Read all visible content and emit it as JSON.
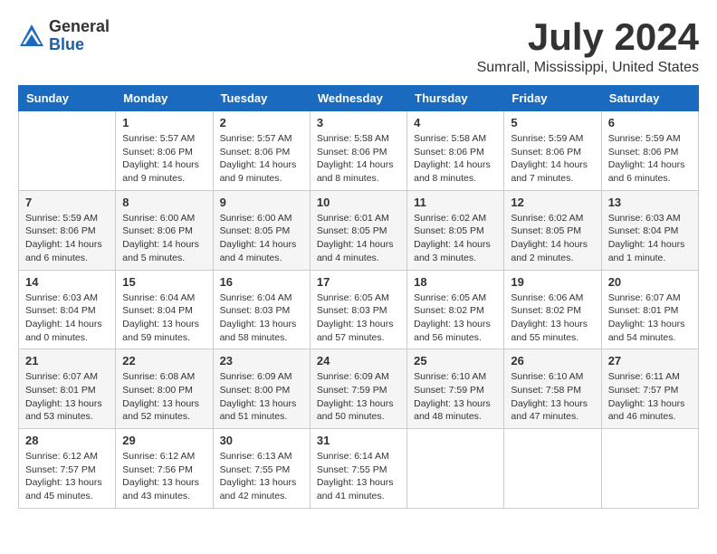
{
  "logo": {
    "general": "General",
    "blue": "Blue"
  },
  "title": {
    "month": "July 2024",
    "location": "Sumrall, Mississippi, United States"
  },
  "calendar": {
    "headers": [
      "Sunday",
      "Monday",
      "Tuesday",
      "Wednesday",
      "Thursday",
      "Friday",
      "Saturday"
    ],
    "weeks": [
      [
        {
          "day": "",
          "info": ""
        },
        {
          "day": "1",
          "info": "Sunrise: 5:57 AM\nSunset: 8:06 PM\nDaylight: 14 hours\nand 9 minutes."
        },
        {
          "day": "2",
          "info": "Sunrise: 5:57 AM\nSunset: 8:06 PM\nDaylight: 14 hours\nand 9 minutes."
        },
        {
          "day": "3",
          "info": "Sunrise: 5:58 AM\nSunset: 8:06 PM\nDaylight: 14 hours\nand 8 minutes."
        },
        {
          "day": "4",
          "info": "Sunrise: 5:58 AM\nSunset: 8:06 PM\nDaylight: 14 hours\nand 8 minutes."
        },
        {
          "day": "5",
          "info": "Sunrise: 5:59 AM\nSunset: 8:06 PM\nDaylight: 14 hours\nand 7 minutes."
        },
        {
          "day": "6",
          "info": "Sunrise: 5:59 AM\nSunset: 8:06 PM\nDaylight: 14 hours\nand 6 minutes."
        }
      ],
      [
        {
          "day": "7",
          "info": "Sunrise: 5:59 AM\nSunset: 8:06 PM\nDaylight: 14 hours\nand 6 minutes."
        },
        {
          "day": "8",
          "info": "Sunrise: 6:00 AM\nSunset: 8:06 PM\nDaylight: 14 hours\nand 5 minutes."
        },
        {
          "day": "9",
          "info": "Sunrise: 6:00 AM\nSunset: 8:05 PM\nDaylight: 14 hours\nand 4 minutes."
        },
        {
          "day": "10",
          "info": "Sunrise: 6:01 AM\nSunset: 8:05 PM\nDaylight: 14 hours\nand 4 minutes."
        },
        {
          "day": "11",
          "info": "Sunrise: 6:02 AM\nSunset: 8:05 PM\nDaylight: 14 hours\nand 3 minutes."
        },
        {
          "day": "12",
          "info": "Sunrise: 6:02 AM\nSunset: 8:05 PM\nDaylight: 14 hours\nand 2 minutes."
        },
        {
          "day": "13",
          "info": "Sunrise: 6:03 AM\nSunset: 8:04 PM\nDaylight: 14 hours\nand 1 minute."
        }
      ],
      [
        {
          "day": "14",
          "info": "Sunrise: 6:03 AM\nSunset: 8:04 PM\nDaylight: 14 hours\nand 0 minutes."
        },
        {
          "day": "15",
          "info": "Sunrise: 6:04 AM\nSunset: 8:04 PM\nDaylight: 13 hours\nand 59 minutes."
        },
        {
          "day": "16",
          "info": "Sunrise: 6:04 AM\nSunset: 8:03 PM\nDaylight: 13 hours\nand 58 minutes."
        },
        {
          "day": "17",
          "info": "Sunrise: 6:05 AM\nSunset: 8:03 PM\nDaylight: 13 hours\nand 57 minutes."
        },
        {
          "day": "18",
          "info": "Sunrise: 6:05 AM\nSunset: 8:02 PM\nDaylight: 13 hours\nand 56 minutes."
        },
        {
          "day": "19",
          "info": "Sunrise: 6:06 AM\nSunset: 8:02 PM\nDaylight: 13 hours\nand 55 minutes."
        },
        {
          "day": "20",
          "info": "Sunrise: 6:07 AM\nSunset: 8:01 PM\nDaylight: 13 hours\nand 54 minutes."
        }
      ],
      [
        {
          "day": "21",
          "info": "Sunrise: 6:07 AM\nSunset: 8:01 PM\nDaylight: 13 hours\nand 53 minutes."
        },
        {
          "day": "22",
          "info": "Sunrise: 6:08 AM\nSunset: 8:00 PM\nDaylight: 13 hours\nand 52 minutes."
        },
        {
          "day": "23",
          "info": "Sunrise: 6:09 AM\nSunset: 8:00 PM\nDaylight: 13 hours\nand 51 minutes."
        },
        {
          "day": "24",
          "info": "Sunrise: 6:09 AM\nSunset: 7:59 PM\nDaylight: 13 hours\nand 50 minutes."
        },
        {
          "day": "25",
          "info": "Sunrise: 6:10 AM\nSunset: 7:59 PM\nDaylight: 13 hours\nand 48 minutes."
        },
        {
          "day": "26",
          "info": "Sunrise: 6:10 AM\nSunset: 7:58 PM\nDaylight: 13 hours\nand 47 minutes."
        },
        {
          "day": "27",
          "info": "Sunrise: 6:11 AM\nSunset: 7:57 PM\nDaylight: 13 hours\nand 46 minutes."
        }
      ],
      [
        {
          "day": "28",
          "info": "Sunrise: 6:12 AM\nSunset: 7:57 PM\nDaylight: 13 hours\nand 45 minutes."
        },
        {
          "day": "29",
          "info": "Sunrise: 6:12 AM\nSunset: 7:56 PM\nDaylight: 13 hours\nand 43 minutes."
        },
        {
          "day": "30",
          "info": "Sunrise: 6:13 AM\nSunset: 7:55 PM\nDaylight: 13 hours\nand 42 minutes."
        },
        {
          "day": "31",
          "info": "Sunrise: 6:14 AM\nSunset: 7:55 PM\nDaylight: 13 hours\nand 41 minutes."
        },
        {
          "day": "",
          "info": ""
        },
        {
          "day": "",
          "info": ""
        },
        {
          "day": "",
          "info": ""
        }
      ]
    ]
  }
}
